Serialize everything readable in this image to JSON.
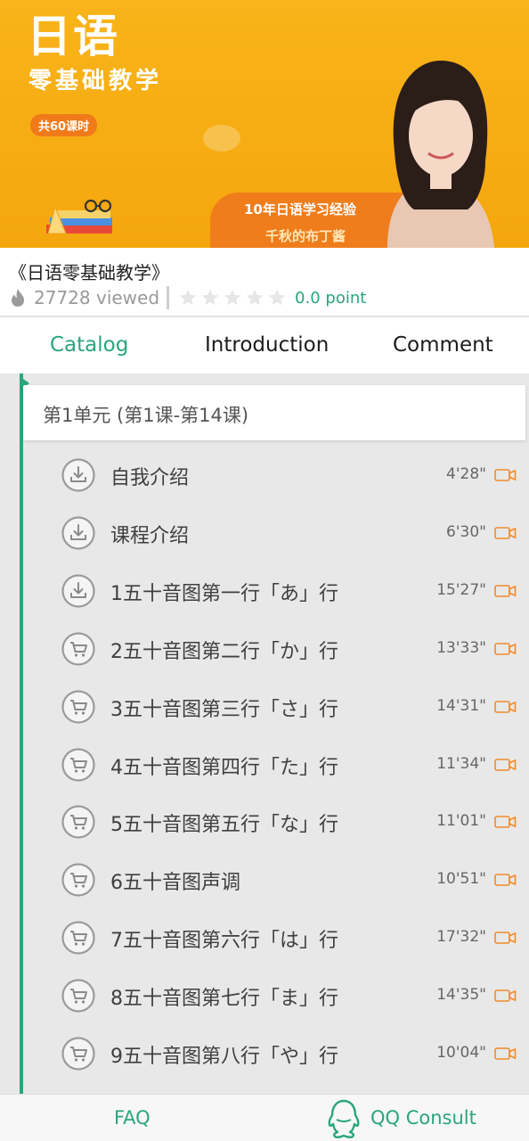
{
  "banner": {
    "title": "日语",
    "subtitle": "零基础教学",
    "badge": "共60课时",
    "tag_line1": "10年日语学习经验",
    "tag_line2": "千秋的布丁酱",
    "illustration_icon": "books-with-glasses-icon",
    "teacher_image": "teacher-portrait"
  },
  "course": {
    "name": "《日语零基础教学》",
    "viewed": "27728 viewed",
    "rating_text": "0.0 point",
    "rating_stars": 0,
    "rating_max": 5
  },
  "tabs": [
    {
      "label": "Catalog",
      "active": true
    },
    {
      "label": "Introduction",
      "active": false
    },
    {
      "label": "Comment",
      "active": false
    }
  ],
  "catalog": {
    "unit_title": "第1单元 (第1课-第14课)",
    "lessons": [
      {
        "title": "自我介绍",
        "duration": "4'28\"",
        "icon": "download-icon"
      },
      {
        "title": "课程介绍",
        "duration": "6'30\"",
        "icon": "download-icon"
      },
      {
        "title": "1五十音图第一行「あ」行",
        "duration": "15'27\"",
        "icon": "download-icon"
      },
      {
        "title": "2五十音图第二行「か」行",
        "duration": "13'33\"",
        "icon": "cart-icon"
      },
      {
        "title": "3五十音图第三行「さ」行",
        "duration": "14'31\"",
        "icon": "cart-icon"
      },
      {
        "title": "4五十音图第四行「た」行",
        "duration": "11'34\"",
        "icon": "cart-icon"
      },
      {
        "title": "5五十音图第五行「な」行",
        "duration": "11'01\"",
        "icon": "cart-icon"
      },
      {
        "title": "6五十音图声调",
        "duration": "10'51\"",
        "icon": "cart-icon"
      },
      {
        "title": "7五十音图第六行「は」行",
        "duration": "17'32\"",
        "icon": "cart-icon"
      },
      {
        "title": "8五十音图第七行「ま」行",
        "duration": "14'35\"",
        "icon": "cart-icon"
      },
      {
        "title": "9五十音图第八行「や」行",
        "duration": "10'04\"",
        "icon": "cart-icon"
      }
    ]
  },
  "bottom_bar": {
    "faq_label": "FAQ",
    "consult_label": "QQ Consult"
  },
  "colors": {
    "accent": "#2aa57d",
    "banner": "#f8b41a",
    "video_icon": "#f08a2c"
  }
}
